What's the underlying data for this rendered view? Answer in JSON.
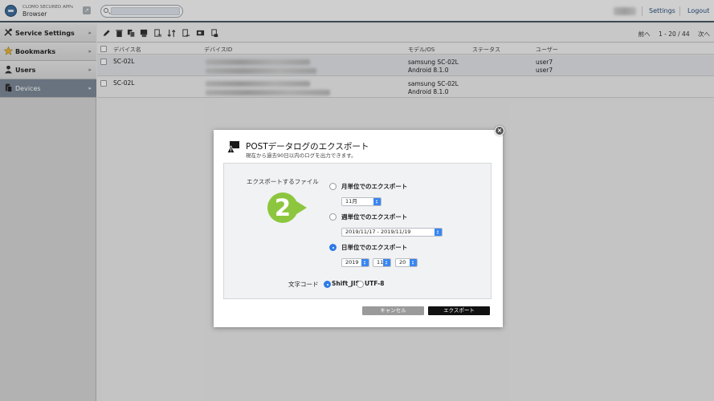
{
  "app": {
    "brand_line1": "CLOMO SECURED APPs",
    "brand_line2": "Browser"
  },
  "header": {
    "settings_label": "Settings",
    "logout_label": "Logout"
  },
  "sidebar": {
    "items": [
      {
        "label": "Service Settings",
        "icon": "tools-icon"
      },
      {
        "label": "Bookmarks",
        "icon": "star-icon"
      },
      {
        "label": "Users",
        "icon": "user-icon"
      },
      {
        "label": "Devices",
        "icon": "device-icon",
        "active": true
      }
    ]
  },
  "pager": {
    "prev": "前へ",
    "range": "1 - 20 / 44",
    "next": "次へ"
  },
  "table": {
    "headers": [
      "デバイス名",
      "デバイスID",
      "モデル/OS",
      "ステータス",
      "ユーザー"
    ],
    "rows": [
      {
        "name": "SC-02L",
        "model": "samsung SC-02L",
        "os": "Android 8.1.0",
        "user1": "user7",
        "user2": "user7"
      },
      {
        "name": "SC-02L",
        "model": "samsung SC-02L",
        "os": "Android 8.1.0",
        "user1": "",
        "user2": ""
      }
    ]
  },
  "dialog": {
    "title": "POSTデータログのエクスポート",
    "subtitle": "現在から過去90日以内のログを出力できます。",
    "export_file_label": "エクスポートするファイル",
    "monthly": {
      "label": "月単位でのエクスポート",
      "value": "11月"
    },
    "weekly": {
      "label": "週単位でのエクスポート",
      "value": "2019/11/17 - 2019/11/19"
    },
    "daily": {
      "label": "日単位でのエクスポート",
      "year": "2019",
      "month": "11",
      "day": "20"
    },
    "charset_label": "文字コード",
    "charset_options": [
      "Shift_JIS",
      "UTF-8"
    ],
    "selected_export": "daily",
    "selected_charset": "Shift_JIS",
    "cancel_label": "キャンセル",
    "export_label": "エクスポート",
    "step_badge": "2"
  },
  "colors": {
    "accent": "#2f7be6",
    "badge": "#8cc63f",
    "header_border": "#4b5764",
    "export_button": "#111111",
    "cancel_button": "#9a9a9a"
  }
}
